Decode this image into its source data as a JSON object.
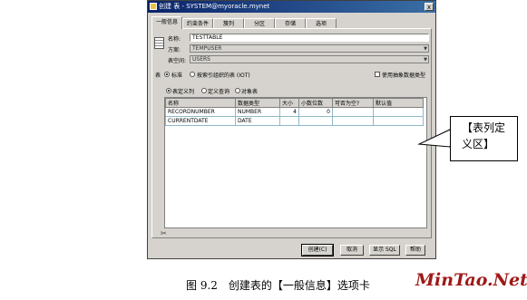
{
  "window": {
    "title": "创建 表 - SYSTEM@myoracle.mynet",
    "close_glyph": "x"
  },
  "tabs": [
    "一般信息",
    "约束条件",
    "簇列",
    "分区",
    "存储",
    "选项"
  ],
  "form": {
    "name_label": "名称:",
    "name_value": "TESTTABLE",
    "schema_label": "方案:",
    "schema_value": "TEMPUSER",
    "tablespace_label": "表空间:",
    "tablespace_value": "USERS",
    "table_label": "表",
    "table_type_standard": "标准",
    "table_type_iot": "按索引组织的表 (IOT)",
    "abstract_type_label": "使用抽象数据类型",
    "view_table": "表定义列",
    "view_sql": "定义查询",
    "view_abstract": "对象表"
  },
  "grid": {
    "headers": [
      "名称",
      "数据类型",
      "大小",
      "小数位数",
      "可否为空?",
      "默认值"
    ],
    "rows": [
      [
        "RECORDNUMBER",
        "NUMBER",
        "4",
        "0",
        "",
        ""
      ],
      [
        "CURRENTDATE",
        "DATE",
        "",
        "",
        "",
        ""
      ]
    ]
  },
  "buttons": {
    "create": "创建(C)",
    "cancel": "取消",
    "show_sql": "显示 SQL",
    "help": "帮助"
  },
  "callout": {
    "line1": "【表列定",
    "line2": "义区】"
  },
  "caption": "图 9.2　创建表的【一般信息】选项卡",
  "logo": "MinTao.Net"
}
